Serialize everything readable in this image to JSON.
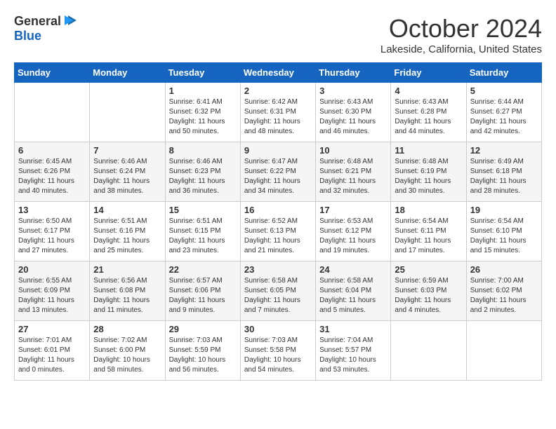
{
  "header": {
    "logo_general": "General",
    "logo_blue": "Blue",
    "month": "October 2024",
    "location": "Lakeside, California, United States"
  },
  "days_of_week": [
    "Sunday",
    "Monday",
    "Tuesday",
    "Wednesday",
    "Thursday",
    "Friday",
    "Saturday"
  ],
  "weeks": [
    [
      {
        "day": "",
        "info": ""
      },
      {
        "day": "",
        "info": ""
      },
      {
        "day": "1",
        "info": "Sunrise: 6:41 AM\nSunset: 6:32 PM\nDaylight: 11 hours and 50 minutes."
      },
      {
        "day": "2",
        "info": "Sunrise: 6:42 AM\nSunset: 6:31 PM\nDaylight: 11 hours and 48 minutes."
      },
      {
        "day": "3",
        "info": "Sunrise: 6:43 AM\nSunset: 6:30 PM\nDaylight: 11 hours and 46 minutes."
      },
      {
        "day": "4",
        "info": "Sunrise: 6:43 AM\nSunset: 6:28 PM\nDaylight: 11 hours and 44 minutes."
      },
      {
        "day": "5",
        "info": "Sunrise: 6:44 AM\nSunset: 6:27 PM\nDaylight: 11 hours and 42 minutes."
      }
    ],
    [
      {
        "day": "6",
        "info": "Sunrise: 6:45 AM\nSunset: 6:26 PM\nDaylight: 11 hours and 40 minutes."
      },
      {
        "day": "7",
        "info": "Sunrise: 6:46 AM\nSunset: 6:24 PM\nDaylight: 11 hours and 38 minutes."
      },
      {
        "day": "8",
        "info": "Sunrise: 6:46 AM\nSunset: 6:23 PM\nDaylight: 11 hours and 36 minutes."
      },
      {
        "day": "9",
        "info": "Sunrise: 6:47 AM\nSunset: 6:22 PM\nDaylight: 11 hours and 34 minutes."
      },
      {
        "day": "10",
        "info": "Sunrise: 6:48 AM\nSunset: 6:21 PM\nDaylight: 11 hours and 32 minutes."
      },
      {
        "day": "11",
        "info": "Sunrise: 6:48 AM\nSunset: 6:19 PM\nDaylight: 11 hours and 30 minutes."
      },
      {
        "day": "12",
        "info": "Sunrise: 6:49 AM\nSunset: 6:18 PM\nDaylight: 11 hours and 28 minutes."
      }
    ],
    [
      {
        "day": "13",
        "info": "Sunrise: 6:50 AM\nSunset: 6:17 PM\nDaylight: 11 hours and 27 minutes."
      },
      {
        "day": "14",
        "info": "Sunrise: 6:51 AM\nSunset: 6:16 PM\nDaylight: 11 hours and 25 minutes."
      },
      {
        "day": "15",
        "info": "Sunrise: 6:51 AM\nSunset: 6:15 PM\nDaylight: 11 hours and 23 minutes."
      },
      {
        "day": "16",
        "info": "Sunrise: 6:52 AM\nSunset: 6:13 PM\nDaylight: 11 hours and 21 minutes."
      },
      {
        "day": "17",
        "info": "Sunrise: 6:53 AM\nSunset: 6:12 PM\nDaylight: 11 hours and 19 minutes."
      },
      {
        "day": "18",
        "info": "Sunrise: 6:54 AM\nSunset: 6:11 PM\nDaylight: 11 hours and 17 minutes."
      },
      {
        "day": "19",
        "info": "Sunrise: 6:54 AM\nSunset: 6:10 PM\nDaylight: 11 hours and 15 minutes."
      }
    ],
    [
      {
        "day": "20",
        "info": "Sunrise: 6:55 AM\nSunset: 6:09 PM\nDaylight: 11 hours and 13 minutes."
      },
      {
        "day": "21",
        "info": "Sunrise: 6:56 AM\nSunset: 6:08 PM\nDaylight: 11 hours and 11 minutes."
      },
      {
        "day": "22",
        "info": "Sunrise: 6:57 AM\nSunset: 6:06 PM\nDaylight: 11 hours and 9 minutes."
      },
      {
        "day": "23",
        "info": "Sunrise: 6:58 AM\nSunset: 6:05 PM\nDaylight: 11 hours and 7 minutes."
      },
      {
        "day": "24",
        "info": "Sunrise: 6:58 AM\nSunset: 6:04 PM\nDaylight: 11 hours and 5 minutes."
      },
      {
        "day": "25",
        "info": "Sunrise: 6:59 AM\nSunset: 6:03 PM\nDaylight: 11 hours and 4 minutes."
      },
      {
        "day": "26",
        "info": "Sunrise: 7:00 AM\nSunset: 6:02 PM\nDaylight: 11 hours and 2 minutes."
      }
    ],
    [
      {
        "day": "27",
        "info": "Sunrise: 7:01 AM\nSunset: 6:01 PM\nDaylight: 11 hours and 0 minutes."
      },
      {
        "day": "28",
        "info": "Sunrise: 7:02 AM\nSunset: 6:00 PM\nDaylight: 10 hours and 58 minutes."
      },
      {
        "day": "29",
        "info": "Sunrise: 7:03 AM\nSunset: 5:59 PM\nDaylight: 10 hours and 56 minutes."
      },
      {
        "day": "30",
        "info": "Sunrise: 7:03 AM\nSunset: 5:58 PM\nDaylight: 10 hours and 54 minutes."
      },
      {
        "day": "31",
        "info": "Sunrise: 7:04 AM\nSunset: 5:57 PM\nDaylight: 10 hours and 53 minutes."
      },
      {
        "day": "",
        "info": ""
      },
      {
        "day": "",
        "info": ""
      }
    ]
  ]
}
